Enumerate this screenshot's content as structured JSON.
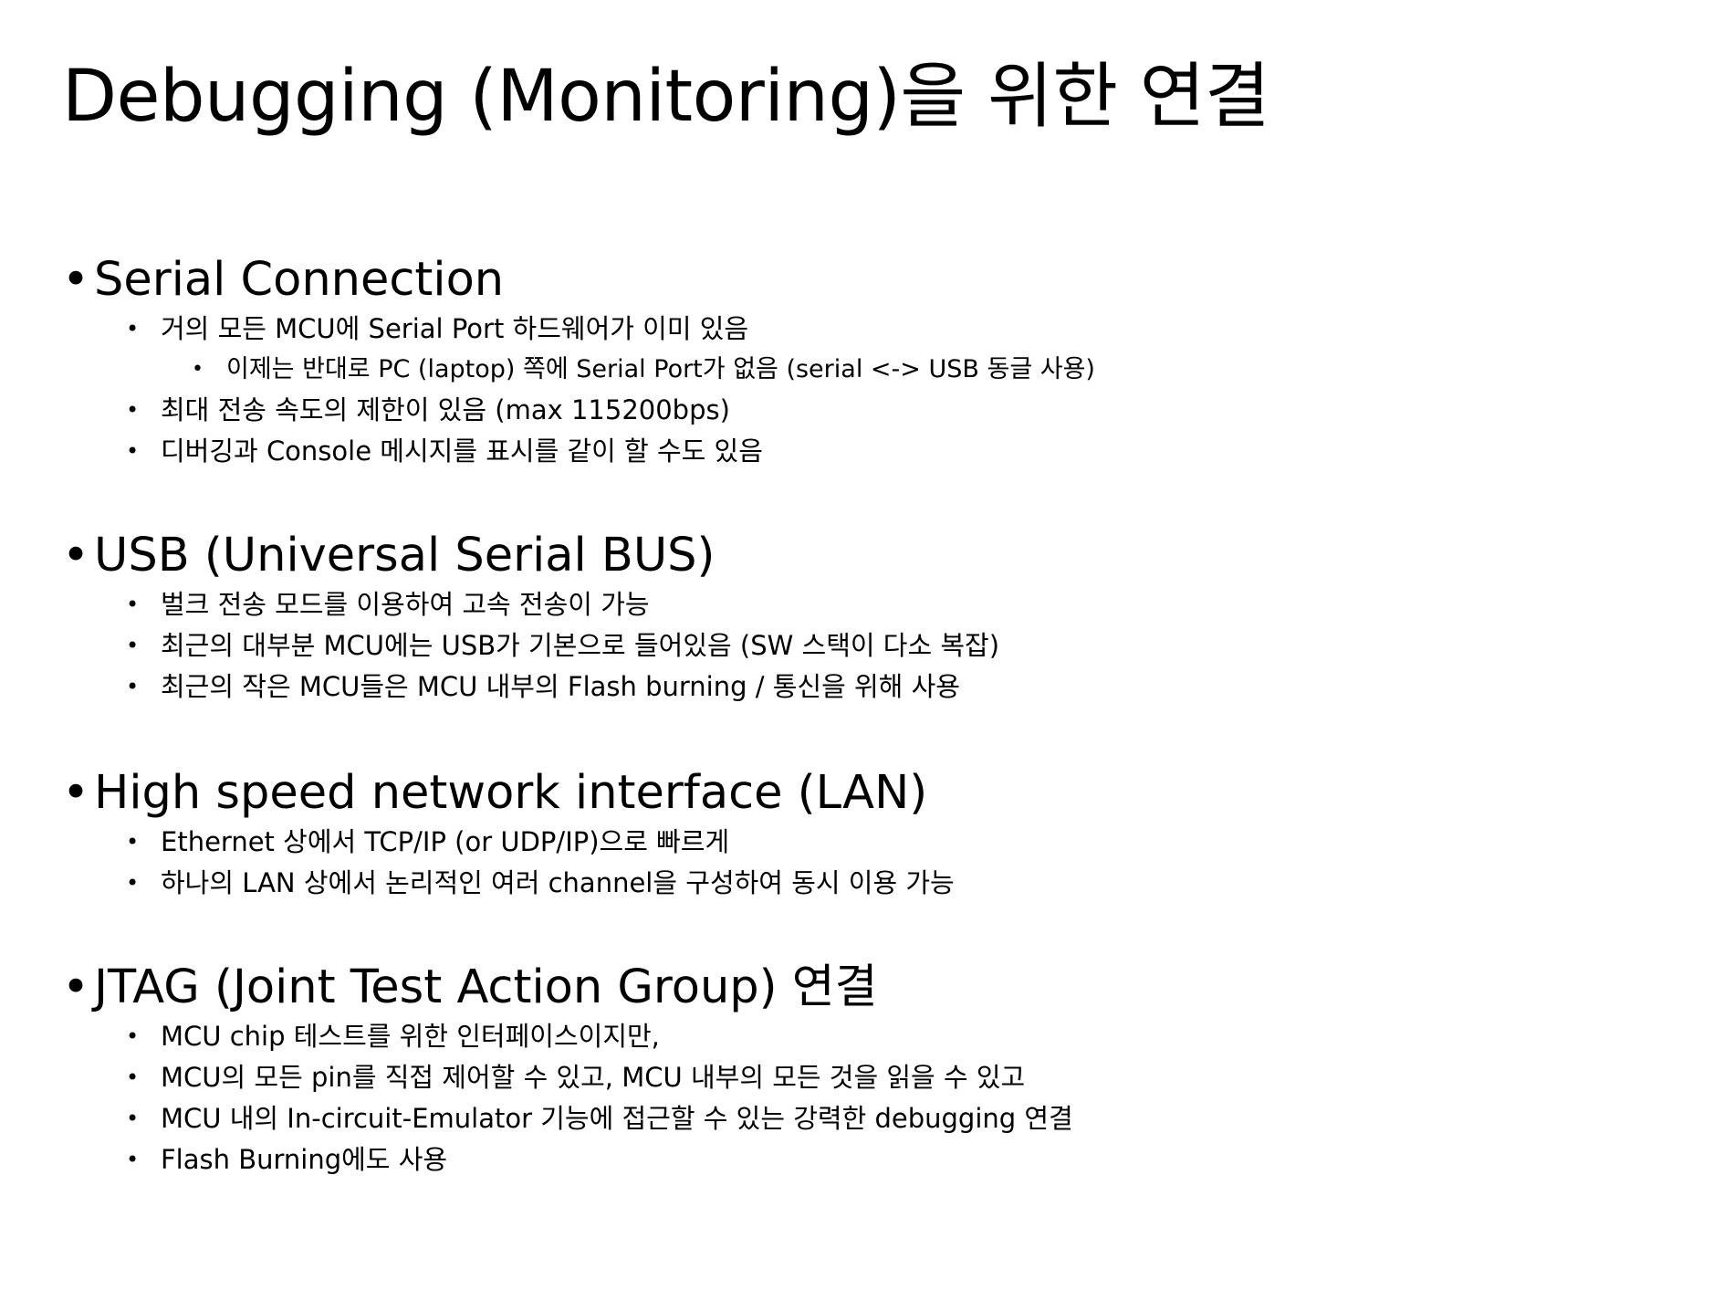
{
  "title": "Debugging (Monitoring)을 위한 연결",
  "bullet_glyph": "•",
  "sections": [
    {
      "heading": "Serial Connection",
      "items": [
        {
          "text": "거의 모든 MCU에 Serial Port 하드웨어가 이미 있음",
          "sub": [
            "이제는 반대로 PC (laptop) 쪽에 Serial Port가 없음 (serial <-> USB 동글 사용)"
          ]
        },
        {
          "text": "최대 전송 속도의 제한이 있음 (max 115200bps)"
        },
        {
          "text": "디버깅과 Console 메시지를 표시를 같이 할 수도 있음"
        }
      ]
    },
    {
      "heading": "USB (Universal Serial BUS)",
      "items": [
        {
          "text": "벌크 전송 모드를 이용하여 고속 전송이 가능"
        },
        {
          "text": "최근의 대부분 MCU에는 USB가 기본으로 들어있음 (SW 스택이 다소 복잡)"
        },
        {
          "text": "최근의 작은 MCU들은 MCU 내부의 Flash burning / 통신을 위해 사용"
        }
      ]
    },
    {
      "heading": "High speed network interface (LAN)",
      "items": [
        {
          "text": "Ethernet 상에서 TCP/IP (or UDP/IP)으로 빠르게"
        },
        {
          "text": "하나의 LAN 상에서 논리적인 여러 channel을 구성하여 동시 이용 가능"
        }
      ]
    },
    {
      "heading": "JTAG (Joint Test Action Group) 연결",
      "items": [
        {
          "text": "MCU chip 테스트를 위한 인터페이스이지만,"
        },
        {
          "text": "MCU의 모든 pin를 직접 제어할 수 있고, MCU 내부의 모든 것을 읽을 수 있고"
        },
        {
          "text": "MCU 내의 In-circuit-Emulator 기능에 접근할 수 있는 강력한 debugging 연결"
        },
        {
          "text": "Flash Burning에도 사용"
        }
      ]
    }
  ]
}
